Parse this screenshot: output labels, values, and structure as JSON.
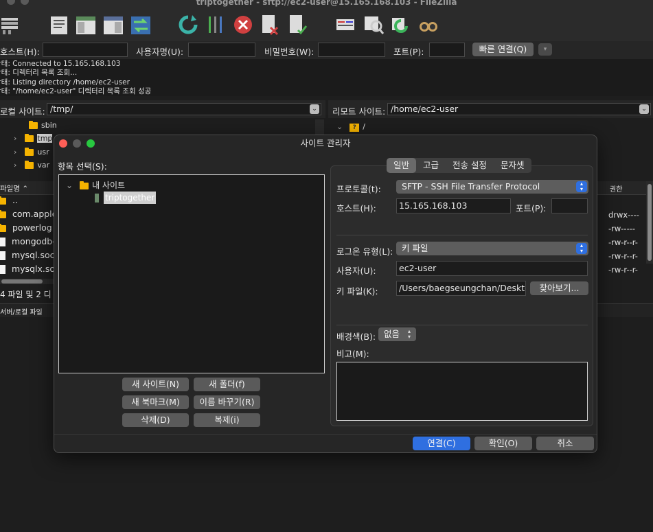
{
  "window": {
    "title": "triptogether - sftp://ec2-user@15.165.168.103 - FileZilla"
  },
  "toolbar": {
    "icons": [
      "site-manager-icon",
      "toggle-log-icon",
      "toggle-local-tree-icon",
      "toggle-remote-tree-icon",
      "transfer-queue-icon",
      "refresh-icon",
      "process-queue-icon",
      "cancel-icon",
      "disconnect-icon",
      "reconnect-icon",
      "directory-listing-filter-icon",
      "compare-icon",
      "sync-browsing-icon",
      "search-icon"
    ]
  },
  "quickconnect": {
    "host_label": "호스트(H):",
    "user_label": "사용자명(U):",
    "pass_label": "비밀번호(W):",
    "port_label": "포트(P):",
    "host_value": "",
    "user_value": "",
    "pass_value": "",
    "port_value": "",
    "connect_label": "빠른 연결(Q)",
    "dropdown_icon": "▾"
  },
  "log": [
    {
      "label": "상태:",
      "text": "Connected to 15.165.168.103"
    },
    {
      "label": "상태:",
      "text": "디렉터리 목록 조회..."
    },
    {
      "label": "상태:",
      "text": "Listing directory /home/ec2-user"
    },
    {
      "label": "상태:",
      "text": "\"/home/ec2-user\" 디렉터리 목록 조회 성공"
    }
  ],
  "local": {
    "site_label": "로컬 사이트:",
    "path": "/tmp/",
    "tree": [
      {
        "name": "sbin",
        "expandable": false
      },
      {
        "name": "tmp",
        "expandable": true
      },
      {
        "name": "usr",
        "expandable": true
      },
      {
        "name": "var",
        "expandable": true
      }
    ],
    "column_filename": "파일명",
    "files": [
      {
        "name": "..",
        "type": "folder"
      },
      {
        "name": "com.apple",
        "type": "folder"
      },
      {
        "name": "powerlog",
        "type": "folder"
      },
      {
        "name": "mongodb-",
        "type": "file"
      },
      {
        "name": "mysql.soc",
        "type": "file"
      },
      {
        "name": "mysqlx.so",
        "type": "file"
      }
    ],
    "status": "4 파일 및 2 디",
    "queue_tab": "서버/로컬 파일"
  },
  "remote": {
    "site_label": "리모트 사이트:",
    "path": "/home/ec2-user",
    "tree_root": "/",
    "column_permissions": "권한",
    "permissions": [
      "drwx----",
      "-rw-----",
      "-rw-r--r-",
      "-rw-r--r-",
      "-rw-r--r-"
    ]
  },
  "dialog": {
    "title": "사이트 관리자",
    "entry_label": "항목 선택(S):",
    "tree_root": "내 사이트",
    "site_name": "triptogether",
    "buttons": {
      "new_site": "새 사이트(N)",
      "new_folder": "새 폴더(f)",
      "new_bookmark": "새 북마크(M)",
      "rename": "이름 바꾸기(R)",
      "delete": "삭제(D)",
      "duplicate": "복제(i)"
    },
    "tabs": [
      "일반",
      "고급",
      "전송 설정",
      "문자셋"
    ],
    "active_tab": "일반",
    "general": {
      "protocol_label": "프로토콜(t):",
      "protocol_value": "SFTP - SSH File Transfer Protocol",
      "host_label": "호스트(H):",
      "host_value": "15.165.168.103",
      "port_label": "포트(P):",
      "port_value": "",
      "logon_type_label": "로그온 유형(L):",
      "logon_type_value": "키 파일",
      "user_label": "사용자(U):",
      "user_value": "ec2-user",
      "keyfile_label": "키 파일(K):",
      "keyfile_value": "/Users/baegseungchan/Deskto",
      "browse_label": "찾아보기...",
      "bgcolor_label": "배경색(B):",
      "bgcolor_value": "없음",
      "comments_label": "비고(M):",
      "comments_value": ""
    },
    "footer": {
      "connect": "연결(C)",
      "ok": "확인(O)",
      "cancel": "취소"
    }
  },
  "colors": {
    "accent": "#2f6fe0",
    "folder": "#f5b300",
    "close": "#ff5f57",
    "minimize": "#5a5a5a",
    "zoom": "#28c840"
  }
}
